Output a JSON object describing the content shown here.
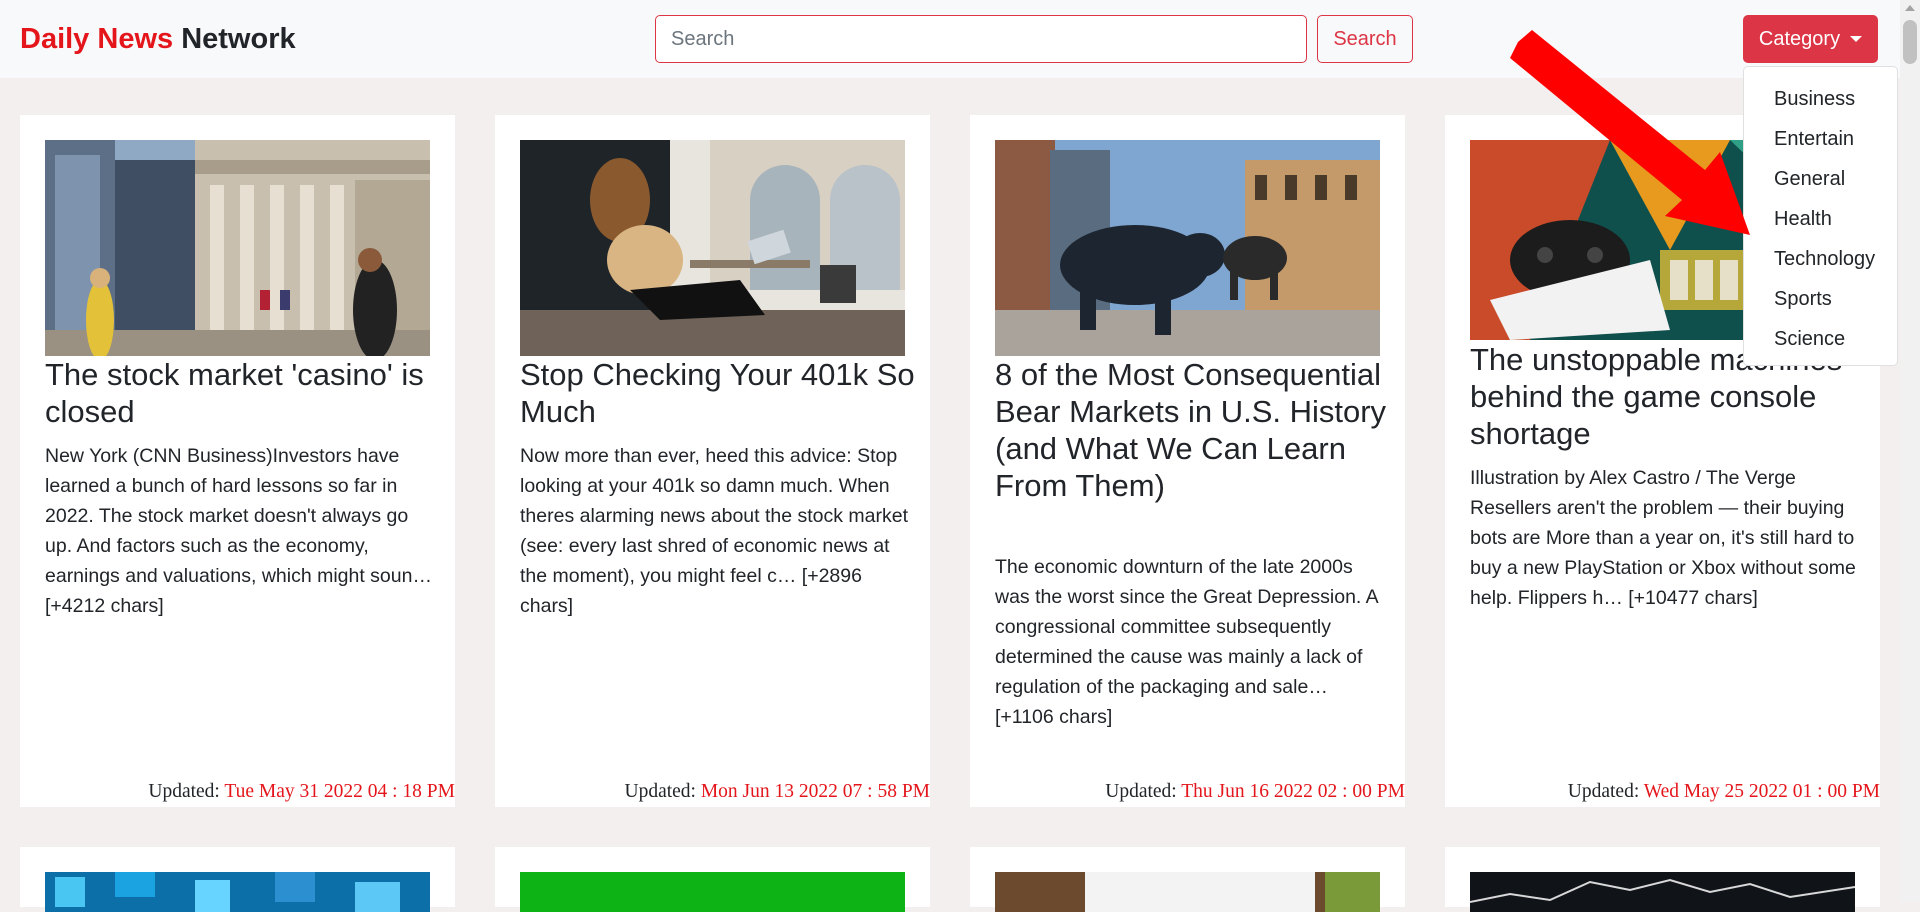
{
  "navbar": {
    "brand_part1": "Daily News",
    "brand_part2": "Network",
    "search_placeholder": "Search",
    "search_button": "Search",
    "category_button": "Category"
  },
  "dropdown": {
    "items": [
      "Business",
      "Entertain",
      "General",
      "Health",
      "Technology",
      "Sports",
      "Science"
    ]
  },
  "cards": [
    {
      "title": "The stock market 'casino' is closed",
      "text": "New York (CNN Business)Investors have learned a bunch of hard lessons so far in 2022. The stock market doesn't always go up. And factors such as the economy, earnings and valuations, which might soun… [+4212 chars]",
      "updated_label": "Updated:",
      "updated_date": "Tue May 31 2022 04 : 18 PM"
    },
    {
      "title": "Stop Checking Your 401k So Much",
      "text": "Now more than ever, heed this advice: Stop looking at your 401k so damn much. When theres alarming news about the stock market (see: every last shred of economic news at the moment), you might feel c… [+2896 chars]",
      "updated_label": "Updated:",
      "updated_date": "Mon Jun 13 2022 07 : 58 PM"
    },
    {
      "title": "8 of the Most Consequential Bear Markets in U.S. History (and What We Can Learn From Them)",
      "text": "The economic downturn of the late 2000s was the worst since the Great Depression. A congressional committee subsequently determined the cause was mainly a lack of regulation of the packaging and sale… [+1106 chars]",
      "updated_label": "Updated:",
      "updated_date": "Thu Jun 16 2022 02 : 00 PM"
    },
    {
      "title": "The unstoppable machines behind the game console shortage",
      "text": "Illustration by Alex Castro / The Verge Resellers aren't the problem — their buying bots are More than a year on, it's still hard to buy a new PlayStation or Xbox without some help. Flippers h… [+10477 chars]",
      "updated_label": "Updated:",
      "updated_date": "Wed May 25 2022 01 : 00 PM"
    }
  ],
  "colors": {
    "brand_red": "#e4161c",
    "danger": "#dc3545",
    "page_bg": "#f4efef"
  },
  "icons": {
    "category_caret": "caret-down-icon",
    "annotation": "red-arrow-annotation"
  }
}
